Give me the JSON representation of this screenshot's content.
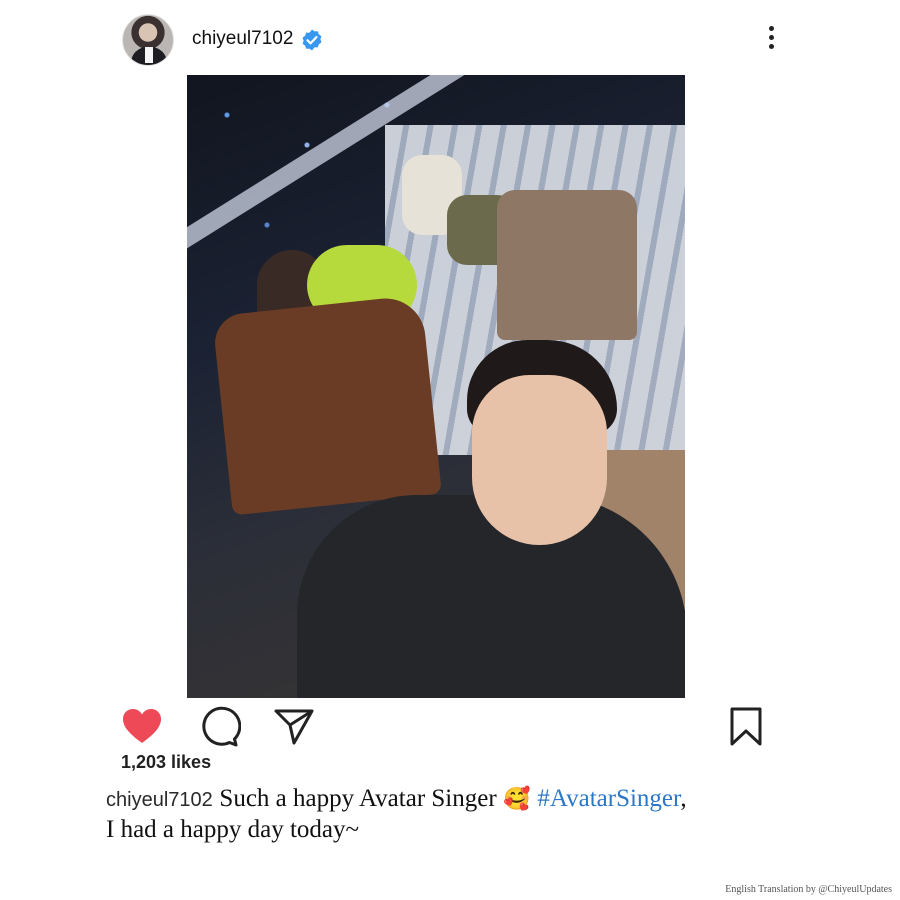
{
  "post": {
    "username": "chiyeul7102",
    "verified": true,
    "more_icon": "more-vertical-icon",
    "image_description_icon": "post-photo",
    "likes_text": "1,203 likes",
    "liked": true,
    "like_color": "#ed4956",
    "caption": {
      "username": "chiyeul7102",
      "text_part1": "Such a happy Avatar Singer",
      "emoji": "🥰",
      "hashtag": "#AvatarSinger",
      "after_hashtag": ",",
      "line2": "I had a happy day today~",
      "hashtag_color": "#2b78c8"
    }
  },
  "icons": {
    "like": "heart-icon",
    "comment": "comment-icon",
    "share": "send-icon",
    "save": "bookmark-icon",
    "verified": "verified-badge-icon"
  },
  "credit": "English Translation by @ChiyeulUpdates"
}
